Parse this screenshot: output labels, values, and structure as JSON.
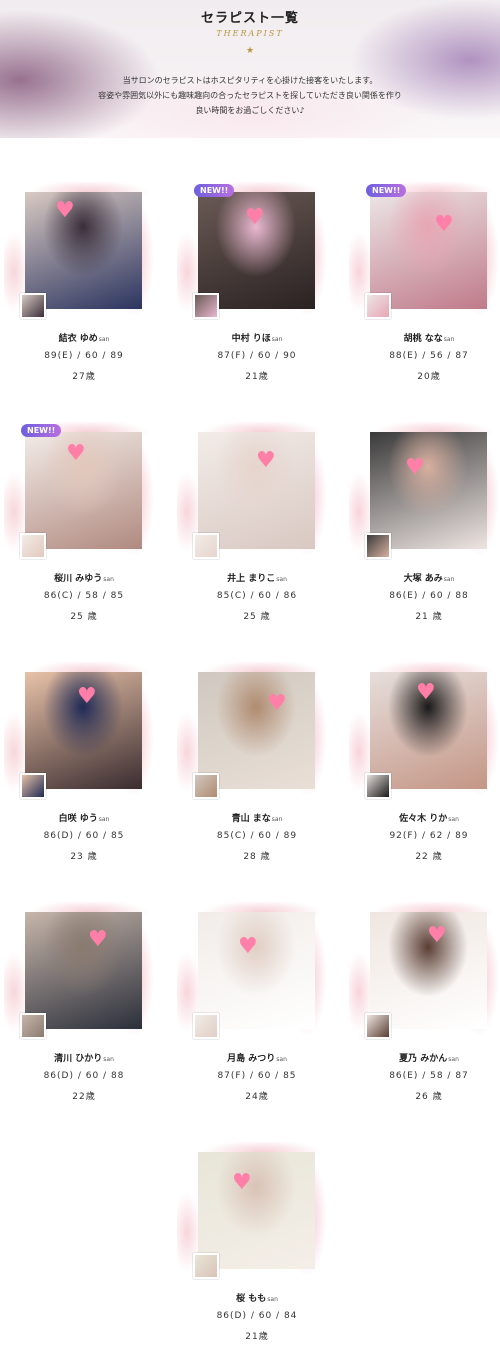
{
  "header": {
    "title": "セラピスト一覧",
    "subtitle": "THERAPIST",
    "star": "★",
    "intro": [
      "当サロンのセラピストはホスピタリティを心掛けた接客をいたします。",
      "容姿や雰囲気以外にも趣味趣向の合ったセラピストを探していただき良い関係を作り",
      "良い時間をお過ごしください♪"
    ]
  },
  "badge_label": "NEW!!",
  "san_label": "san",
  "therapists": [
    {
      "name": "結衣 ゆめ",
      "measurements": "89(E) / 60 / 89",
      "age": "27歳",
      "is_new": false,
      "photo_colors": [
        "#d8c9c2",
        "#3a2e3a",
        "#2c3560"
      ]
    },
    {
      "name": "中村 りほ",
      "measurements": "87(F) / 60 / 90",
      "age": "21歳",
      "is_new": true,
      "photo_colors": [
        "#6a5a55",
        "#e9b8d0",
        "#2a2222"
      ]
    },
    {
      "name": "胡桃 なな",
      "measurements": "88(E) / 56 / 87",
      "age": "20歳",
      "is_new": true,
      "photo_colors": [
        "#ece6e6",
        "#e7a6b4",
        "#c07a8a"
      ]
    },
    {
      "name": "桜川 みゆう",
      "measurements": "86(C) / 58 / 85",
      "age": "25 歳",
      "is_new": true,
      "photo_colors": [
        "#f3ece8",
        "#e2c8bc",
        "#b08a80"
      ]
    },
    {
      "name": "井上 まりこ",
      "measurements": "85(C) / 60 / 86",
      "age": "25 歳",
      "is_new": false,
      "photo_colors": [
        "#f2ece8",
        "#e6d4cc",
        "#d9c8c2"
      ]
    },
    {
      "name": "大塚 あみ",
      "measurements": "86(E) / 60 / 88",
      "age": "21 歳",
      "is_new": false,
      "photo_colors": [
        "#3a3a3a",
        "#d8b0a0",
        "#eee5e2"
      ]
    },
    {
      "name": "白咲 ゆう",
      "measurements": "86(D) / 60 / 85",
      "age": "23 歳",
      "is_new": false,
      "photo_colors": [
        "#e8c2a8",
        "#1f2a55",
        "#3a2c30"
      ]
    },
    {
      "name": "青山 まな",
      "measurements": "85(C) / 60 / 89",
      "age": "28 歳",
      "is_new": false,
      "photo_colors": [
        "#d0c8c0",
        "#b08b70",
        "#e9dfd6"
      ]
    },
    {
      "name": "佐々木 りか",
      "measurements": "92(F) / 62 / 89",
      "age": "22 歳",
      "is_new": false,
      "photo_colors": [
        "#e6dedb",
        "#1a1a1a",
        "#c49686"
      ]
    },
    {
      "name": "清川 ひかり",
      "measurements": "86(D) / 60 / 88",
      "age": "22歳",
      "is_new": false,
      "photo_colors": [
        "#c7b6aa",
        "#8a7a70",
        "#2b2f3b"
      ]
    },
    {
      "name": "月島 みつり",
      "measurements": "87(F) / 60 / 85",
      "age": "24歳",
      "is_new": false,
      "photo_colors": [
        "#f1ece8",
        "#e0cec4",
        "#ffffff"
      ]
    },
    {
      "name": "夏乃 みかん",
      "measurements": "86(E) / 58 / 87",
      "age": "26 歳",
      "is_new": false,
      "photo_colors": [
        "#efe6e0",
        "#5a3e34",
        "#ffffff"
      ]
    },
    {
      "name": "桜 もも",
      "measurements": "86(D) / 60 / 84",
      "age": "21歳",
      "is_new": false,
      "photo_colors": [
        "#e8e6d8",
        "#d9c2b6",
        "#f4eee8"
      ]
    }
  ],
  "colors": {
    "accent_gold": "#b8973e",
    "badge_start": "#6e5fe0",
    "badge_end": "#b76fe0",
    "brush_pink": "#ec96a5",
    "heart_pink": "#ff7fa8"
  },
  "icons": {
    "heart": "heart-icon",
    "star": "star-icon"
  }
}
